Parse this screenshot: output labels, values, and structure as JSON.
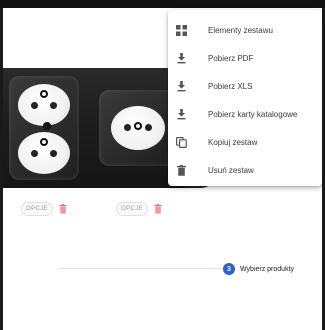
{
  "menu": {
    "items": [
      {
        "label": "Elementy zestawu",
        "icon": "grid-icon"
      },
      {
        "label": "Pobierz PDF",
        "icon": "download-icon"
      },
      {
        "label": "Pobierz XLS",
        "icon": "download-icon"
      },
      {
        "label": "Pobierz karty katalogowe",
        "icon": "download-icon"
      },
      {
        "label": "Kopiuj zestaw",
        "icon": "copy-icon"
      },
      {
        "label": "Usuń zestaw",
        "icon": "trash-icon"
      }
    ]
  },
  "products": [
    {
      "options_label": "OPCJE"
    },
    {
      "options_label": "OPCJE"
    }
  ],
  "progress": {
    "step_number": "3",
    "step_label": "Wybierz produkty"
  },
  "colors": {
    "accent": "#2f5fd0",
    "delete": "#e57373",
    "menu_text": "#3a3a3a",
    "icon": "#555555"
  }
}
